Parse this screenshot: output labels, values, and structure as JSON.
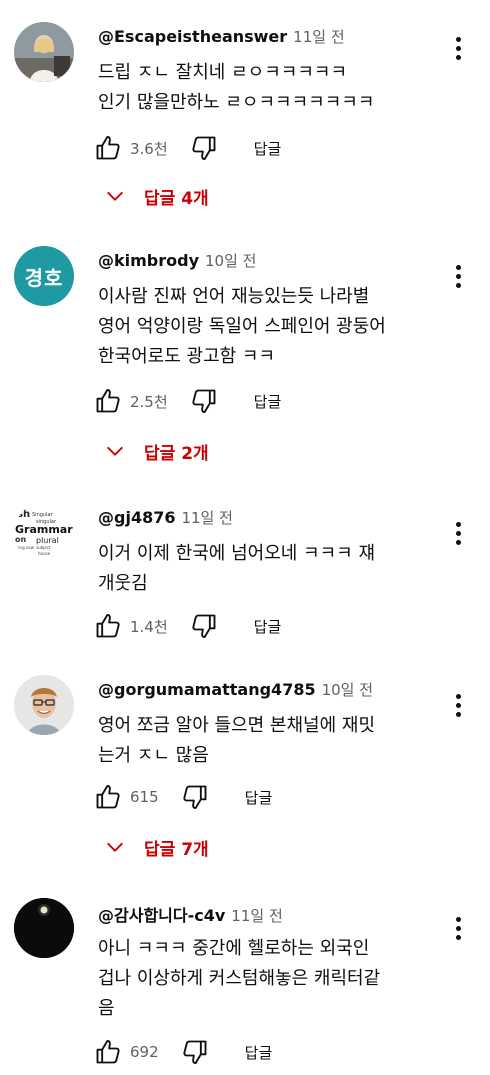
{
  "reply_button_label": "답글",
  "accent_color": "#cc0000",
  "comments": [
    {
      "author": "@Escapeistheanswer",
      "time": "11일 전",
      "text": "드립 ㅈㄴ 잘치네 ㄹㅇㅋㅋㅋㅋㅋ\n인기 많을만하노 ㄹㅇㅋㅋㅋㅋㅋㅋㅋ",
      "likes": "3.6천",
      "replies": "답글 4개",
      "avatar": "person-photo"
    },
    {
      "author": "@kimbrody",
      "time": "10일 전",
      "text": "이사람 진짜 언어 재능있는듯 나라별\n영어 억양이랑 독일어 스페인어 광둥어\n한국어로도 광고함 ㅋㅋ",
      "likes": "2.5천",
      "replies": "답글 2개",
      "avatar_text": "경호",
      "avatar_color": "#1f9aa3"
    },
    {
      "author": "@gj4876",
      "time": "11일 전",
      "text": "이거 이제 한국에 넘어오네 ㅋㅋㅋ 쟤\n개웃김",
      "likes": "1.4천",
      "avatar": "grammar-word-cloud"
    },
    {
      "author": "@gorgumamattang4785",
      "time": "10일 전",
      "text": "영어 쪼금 알아 들으면 본채널에 재밋\n는거 ㅈㄴ 많음",
      "likes": "615",
      "replies": "답글 7개",
      "avatar": "man-with-glasses"
    },
    {
      "author": "@감사합니다-c4v",
      "time": "11일 전",
      "text": "아니 ㅋㅋㅋ 중간에 헬로하는 외국인\n겁나 이상하게 커스텀해놓은 캐릭터같\n음",
      "likes": "692",
      "avatar": "dark-moon"
    }
  ]
}
